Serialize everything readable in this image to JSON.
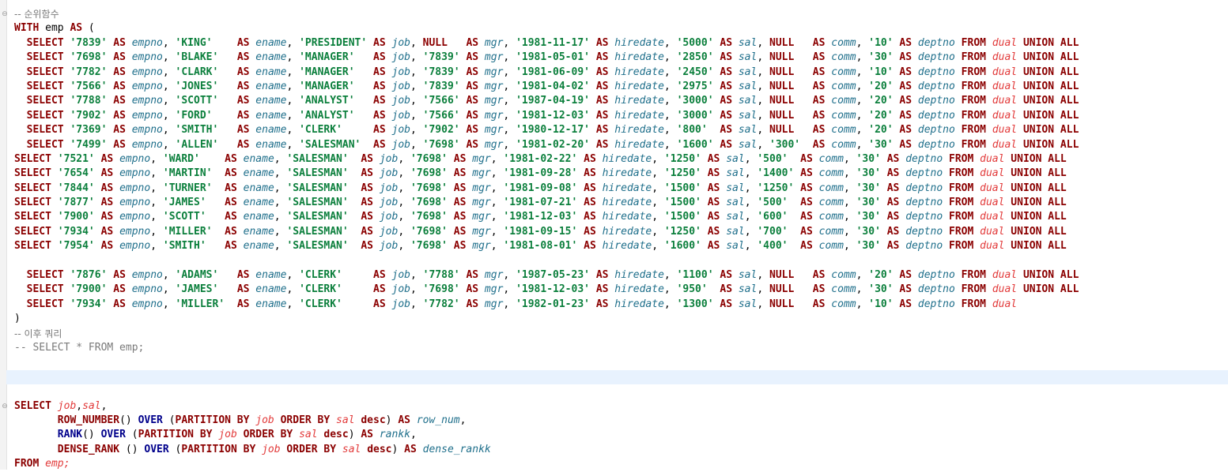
{
  "editor": {
    "lines": [
      {
        "fold": "⊖",
        "tokens": [
          {
            "t": "-- 순위함수",
            "c": "cmt"
          }
        ]
      },
      {
        "tokens": [
          {
            "t": "WITH",
            "c": "kw2"
          },
          {
            "t": " emp ",
            "c": "plain"
          },
          {
            "t": "AS",
            "c": "kw2"
          },
          {
            "t": " (",
            "c": "punct"
          }
        ]
      },
      {
        "row": {
          "indent": "  ",
          "empno": "'7839'",
          "ename": "'KING'   ",
          "job": "'PRESIDENT'",
          "mgr": "NULL  ",
          "hiredate": "'1981-11-17'",
          "sal": "'5000'",
          "comm": "NULL  ",
          "deptno": "'10'",
          "union": true
        }
      },
      {
        "row": {
          "indent": "  ",
          "empno": "'7698'",
          "ename": "'BLAKE'  ",
          "job": "'MANAGER'  ",
          "mgr": "'7839'",
          "hiredate": "'1981-05-01'",
          "sal": "'2850'",
          "comm": "NULL  ",
          "deptno": "'30'",
          "union": true
        }
      },
      {
        "row": {
          "indent": "  ",
          "empno": "'7782'",
          "ename": "'CLARK'  ",
          "job": "'MANAGER'  ",
          "mgr": "'7839'",
          "hiredate": "'1981-06-09'",
          "sal": "'2450'",
          "comm": "NULL  ",
          "deptno": "'10'",
          "union": true
        }
      },
      {
        "row": {
          "indent": "  ",
          "empno": "'7566'",
          "ename": "'JONES'  ",
          "job": "'MANAGER'  ",
          "mgr": "'7839'",
          "hiredate": "'1981-04-02'",
          "sal": "'2975'",
          "comm": "NULL  ",
          "deptno": "'20'",
          "union": true
        }
      },
      {
        "row": {
          "indent": "  ",
          "empno": "'7788'",
          "ename": "'SCOTT'  ",
          "job": "'ANALYST'  ",
          "mgr": "'7566'",
          "hiredate": "'1987-04-19'",
          "sal": "'3000'",
          "comm": "NULL  ",
          "deptno": "'20'",
          "union": true
        }
      },
      {
        "row": {
          "indent": "  ",
          "empno": "'7902'",
          "ename": "'FORD'   ",
          "job": "'ANALYST'  ",
          "mgr": "'7566'",
          "hiredate": "'1981-12-03'",
          "sal": "'3000'",
          "comm": "NULL  ",
          "deptno": "'20'",
          "union": true
        }
      },
      {
        "row": {
          "indent": "  ",
          "empno": "'7369'",
          "ename": "'SMITH'  ",
          "job": "'CLERK'    ",
          "mgr": "'7902'",
          "hiredate": "'1980-12-17'",
          "sal": "'800' ",
          "comm": "NULL  ",
          "deptno": "'20'",
          "union": true
        }
      },
      {
        "row": {
          "indent": "  ",
          "empno": "'7499'",
          "ename": "'ALLEN'  ",
          "job": "'SALESMAN' ",
          "mgr": "'7698'",
          "hiredate": "'1981-02-20'",
          "sal": "'1600'",
          "comm": "'300' ",
          "deptno": "'30'",
          "union": true
        }
      },
      {
        "row": {
          "indent": "",
          "empno": "'7521'",
          "ename": "'WARD'   ",
          "job": "'SALESMAN' ",
          "mgr": "'7698'",
          "hiredate": "'1981-02-22'",
          "sal": "'1250'",
          "comm": "'500' ",
          "deptno": "'30'",
          "union": true
        }
      },
      {
        "row": {
          "indent": "",
          "empno": "'7654'",
          "ename": "'MARTIN' ",
          "job": "'SALESMAN' ",
          "mgr": "'7698'",
          "hiredate": "'1981-09-28'",
          "sal": "'1250'",
          "comm": "'1400'",
          "deptno": "'30'",
          "union": true
        }
      },
      {
        "row": {
          "indent": "",
          "empno": "'7844'",
          "ename": "'TURNER' ",
          "job": "'SALESMAN' ",
          "mgr": "'7698'",
          "hiredate": "'1981-09-08'",
          "sal": "'1500'",
          "comm": "'1250'",
          "deptno": "'30'",
          "union": true
        }
      },
      {
        "row": {
          "indent": "",
          "empno": "'7877'",
          "ename": "'JAMES'  ",
          "job": "'SALESMAN' ",
          "mgr": "'7698'",
          "hiredate": "'1981-07-21'",
          "sal": "'1500'",
          "comm": "'500' ",
          "deptno": "'30'",
          "union": true
        }
      },
      {
        "row": {
          "indent": "",
          "empno": "'7900'",
          "ename": "'SCOTT'  ",
          "job": "'SALESMAN' ",
          "mgr": "'7698'",
          "hiredate": "'1981-12-03'",
          "sal": "'1500'",
          "comm": "'600' ",
          "deptno": "'30'",
          "union": true
        }
      },
      {
        "row": {
          "indent": "",
          "empno": "'7934'",
          "ename": "'MILLER' ",
          "job": "'SALESMAN' ",
          "mgr": "'7698'",
          "hiredate": "'1981-09-15'",
          "sal": "'1250'",
          "comm": "'700' ",
          "deptno": "'30'",
          "union": true
        }
      },
      {
        "row": {
          "indent": "",
          "empno": "'7954'",
          "ename": "'SMITH'  ",
          "job": "'SALESMAN' ",
          "mgr": "'7698'",
          "hiredate": "'1981-08-01'",
          "sal": "'1600'",
          "comm": "'400' ",
          "deptno": "'30'",
          "union": true
        }
      },
      {
        "tokens": []
      },
      {
        "row": {
          "indent": "  ",
          "empno": "'7876'",
          "ename": "'ADAMS'  ",
          "job": "'CLERK'    ",
          "mgr": "'7788'",
          "hiredate": "'1987-05-23'",
          "sal": "'1100'",
          "comm": "NULL  ",
          "deptno": "'20'",
          "union": true
        }
      },
      {
        "row": {
          "indent": "  ",
          "empno": "'7900'",
          "ename": "'JAMES'  ",
          "job": "'CLERK'    ",
          "mgr": "'7698'",
          "hiredate": "'1981-12-03'",
          "sal": "'950' ",
          "comm": "NULL  ",
          "deptno": "'30'",
          "union": true
        }
      },
      {
        "row": {
          "indent": "  ",
          "empno": "'7934'",
          "ename": "'MILLER' ",
          "job": "'CLERK'    ",
          "mgr": "'7782'",
          "hiredate": "'1982-01-23'",
          "sal": "'1300'",
          "comm": "NULL  ",
          "deptno": "'10'",
          "union": false
        }
      },
      {
        "tokens": [
          {
            "t": ")",
            "c": "punct"
          }
        ]
      },
      {
        "tokens": [
          {
            "t": "-- 이후 쿼리",
            "c": "cmt"
          }
        ]
      },
      {
        "tokens": [
          {
            "t": "-- SELECT * FROM emp;",
            "c": "cmt-code"
          }
        ]
      },
      {
        "tokens": []
      },
      {
        "current": true,
        "tokens": []
      },
      {
        "tokens": []
      },
      {
        "fold": "⊖",
        "tokens": [
          {
            "t": "SELECT",
            "c": "kw2"
          },
          {
            "t": " ",
            "c": "plain"
          },
          {
            "t": "job",
            "c": "tbl"
          },
          {
            "t": ",",
            "c": "punct"
          },
          {
            "t": "sal",
            "c": "tbl"
          },
          {
            "t": ",",
            "c": "punct"
          }
        ]
      },
      {
        "tokens": [
          {
            "t": "       ",
            "c": "plain"
          },
          {
            "t": "ROW_NUMBER",
            "c": "kw2"
          },
          {
            "t": "() ",
            "c": "punct"
          },
          {
            "t": "OVER",
            "c": "kwb"
          },
          {
            "t": " (",
            "c": "punct"
          },
          {
            "t": "PARTITION BY",
            "c": "kw2"
          },
          {
            "t": " ",
            "c": "plain"
          },
          {
            "t": "job",
            "c": "tbl"
          },
          {
            "t": " ",
            "c": "plain"
          },
          {
            "t": "ORDER BY",
            "c": "kw2"
          },
          {
            "t": " ",
            "c": "plain"
          },
          {
            "t": "sal",
            "c": "tbl"
          },
          {
            "t": " ",
            "c": "plain"
          },
          {
            "t": "desc",
            "c": "kw2"
          },
          {
            "t": ") ",
            "c": "punct"
          },
          {
            "t": "AS",
            "c": "kw2"
          },
          {
            "t": " ",
            "c": "plain"
          },
          {
            "t": "row_num",
            "c": "id"
          },
          {
            "t": ",",
            "c": "punct"
          }
        ]
      },
      {
        "tokens": [
          {
            "t": "       ",
            "c": "plain"
          },
          {
            "t": "RANK",
            "c": "kwb"
          },
          {
            "t": "() ",
            "c": "punct"
          },
          {
            "t": "OVER",
            "c": "kwb"
          },
          {
            "t": " (",
            "c": "punct"
          },
          {
            "t": "PARTITION BY",
            "c": "kw2"
          },
          {
            "t": " ",
            "c": "plain"
          },
          {
            "t": "job",
            "c": "tbl"
          },
          {
            "t": " ",
            "c": "plain"
          },
          {
            "t": "ORDER BY",
            "c": "kw2"
          },
          {
            "t": " ",
            "c": "plain"
          },
          {
            "t": "sal",
            "c": "tbl"
          },
          {
            "t": " ",
            "c": "plain"
          },
          {
            "t": "desc",
            "c": "kw2"
          },
          {
            "t": ") ",
            "c": "punct"
          },
          {
            "t": "AS",
            "c": "kw2"
          },
          {
            "t": " ",
            "c": "plain"
          },
          {
            "t": "rankk",
            "c": "id"
          },
          {
            "t": ",",
            "c": "punct"
          }
        ]
      },
      {
        "tokens": [
          {
            "t": "       ",
            "c": "plain"
          },
          {
            "t": "DENSE_RANK",
            "c": "kw2"
          },
          {
            "t": " () ",
            "c": "punct"
          },
          {
            "t": "OVER",
            "c": "kwb"
          },
          {
            "t": " (",
            "c": "punct"
          },
          {
            "t": "PARTITION BY",
            "c": "kw2"
          },
          {
            "t": " ",
            "c": "plain"
          },
          {
            "t": "job",
            "c": "tbl"
          },
          {
            "t": " ",
            "c": "plain"
          },
          {
            "t": "ORDER BY",
            "c": "kw2"
          },
          {
            "t": " ",
            "c": "plain"
          },
          {
            "t": "sal",
            "c": "tbl"
          },
          {
            "t": " ",
            "c": "plain"
          },
          {
            "t": "desc",
            "c": "kw2"
          },
          {
            "t": ") ",
            "c": "punct"
          },
          {
            "t": "AS",
            "c": "kw2"
          },
          {
            "t": " ",
            "c": "plain"
          },
          {
            "t": "dense_rankk",
            "c": "id"
          }
        ]
      },
      {
        "tokens": [
          {
            "t": "FROM",
            "c": "kw2"
          },
          {
            "t": " ",
            "c": "plain"
          },
          {
            "t": "emp",
            "c": "tbl"
          },
          {
            "t": ";",
            "c": "tbl"
          }
        ]
      }
    ],
    "keywords": {
      "select": "SELECT",
      "as": "AS",
      "from": "FROM",
      "union_all": "UNION ALL",
      "dual": "dual",
      "cols": {
        "empno": "empno",
        "ename": "ename",
        "job": "job",
        "mgr": "mgr",
        "hiredate": "hiredate",
        "sal": "sal",
        "comm": "comm",
        "deptno": "deptno"
      }
    }
  }
}
